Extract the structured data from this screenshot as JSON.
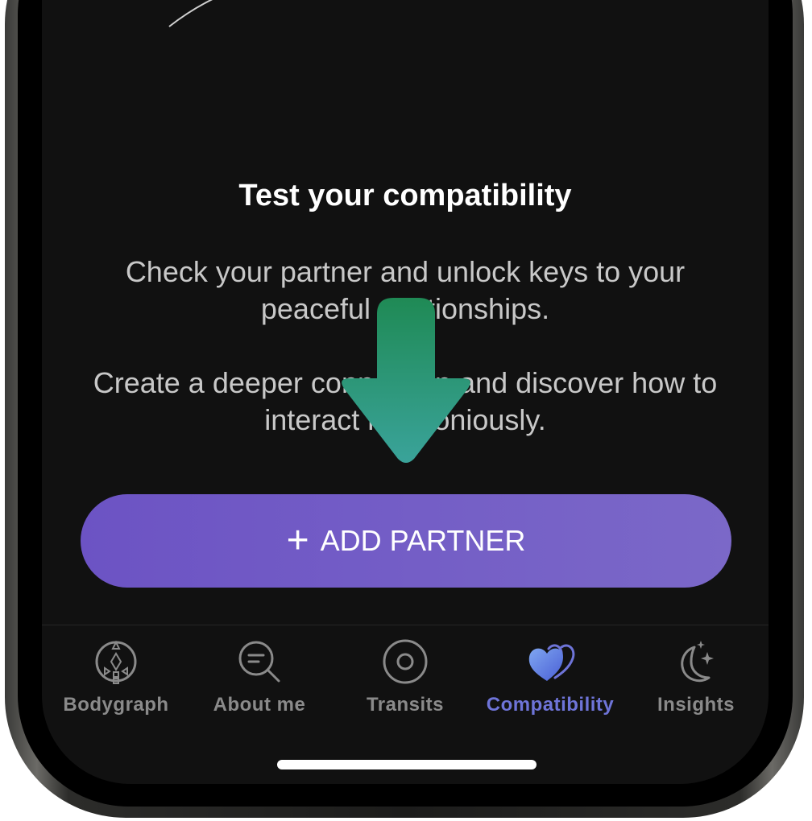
{
  "content": {
    "title": "Test your compatibility",
    "paragraph1": "Check your partner and unlock keys to your peaceful relationships.",
    "paragraph2": "Create a deeper connection and discover how to interact harmoniously."
  },
  "add_button": {
    "plus": "+",
    "label": "ADD PARTNER"
  },
  "tabs": [
    {
      "label": "Bodygraph",
      "icon": "bodygraph-icon",
      "active": false
    },
    {
      "label": "About me",
      "icon": "search-text-icon",
      "active": false
    },
    {
      "label": "Transits",
      "icon": "target-icon",
      "active": false
    },
    {
      "label": "Compatibility",
      "icon": "hearts-icon",
      "active": true
    },
    {
      "label": "Insights",
      "icon": "moon-stars-icon",
      "active": false
    }
  ],
  "colors": {
    "background": "#111111",
    "button_gradient_start": "#6c53c4",
    "button_gradient_end": "#7b68c8",
    "active_tab": "#6e74d8",
    "inactive_tab": "#8a8a8a",
    "arrow_top": "#1f8a55",
    "arrow_bottom": "#3aa39a"
  }
}
